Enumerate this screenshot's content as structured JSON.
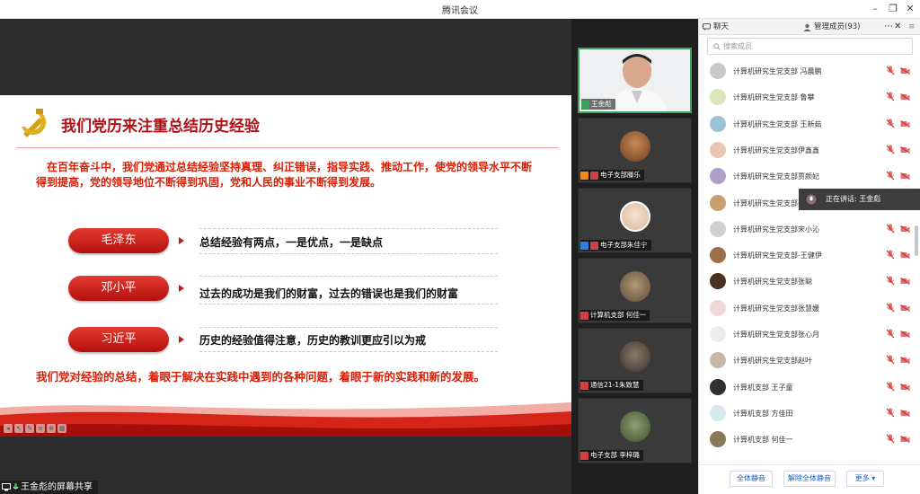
{
  "window": {
    "title": "腾讯会议"
  },
  "slide": {
    "title": "我们党历来注重总结历史经验",
    "intro": "在百年奋斗中，我们党通过总结经验坚持真理、纠正错误，指导实践、推动工作，使党的领导水平不断得到提高，党的领导地位不断得到巩固，党和人民的事业不断得到发展。",
    "leaders": [
      {
        "name": "毛泽东",
        "quote": "总结经验有两点，一是优点，一是缺点"
      },
      {
        "name": "邓小平",
        "quote": "过去的成功是我们的财富，过去的错误也是我们的财富"
      },
      {
        "name": "习近平",
        "quote": "历史的经验值得注意，历史的教训更应引以为戒"
      }
    ],
    "conclusion": "我们党对经验的总结，着眼于解决在实践中遇到的各种问题，着眼于新的实践和新的发展。"
  },
  "share_label": "王金彪的屏幕共享",
  "video_tiles": [
    {
      "name": "王金彪"
    },
    {
      "name": "电子支部滕乐"
    },
    {
      "name": "电子支部朱佳宁"
    },
    {
      "name": "计算机支部 何佳一"
    },
    {
      "name": "通信21-1朱致慧"
    },
    {
      "name": "电子支部 李梓璐"
    }
  ],
  "panel": {
    "chat_tab": "聊天",
    "members_tab": "管理成员(93)",
    "search_placeholder": "搜索成员",
    "members": [
      "计算机研究生党支部 冯晨鹏",
      "计算机研究生党支部 鲁攀",
      "计算机研究生党支部 王新茹",
      "计算机研究生党支部伊鑫鑫",
      "计算机研究生党支部贾颜妃",
      "计算机研究生党支部聂",
      "计算机研究生党支部宋小沁",
      "计算机研究生党支部-王健伊",
      "计算机研究生党支部张聪",
      "计算机研究生党支部张慧媛",
      "计算机研究生党支部张心月",
      "计算机研究生党支部赵叶",
      "计算机支部 王子童",
      "计算机支部 方佳田",
      "计算机支部 何佳一"
    ],
    "speaking_label": "正在讲话: 王金彪",
    "buttons": {
      "mute_all": "全体静音",
      "unmute_all": "解除全体静音",
      "more": "更多 ▾"
    }
  },
  "colors": {
    "accent_red": "#d81e06",
    "title_red": "#b00f16",
    "link_blue": "#1b5fc1"
  }
}
